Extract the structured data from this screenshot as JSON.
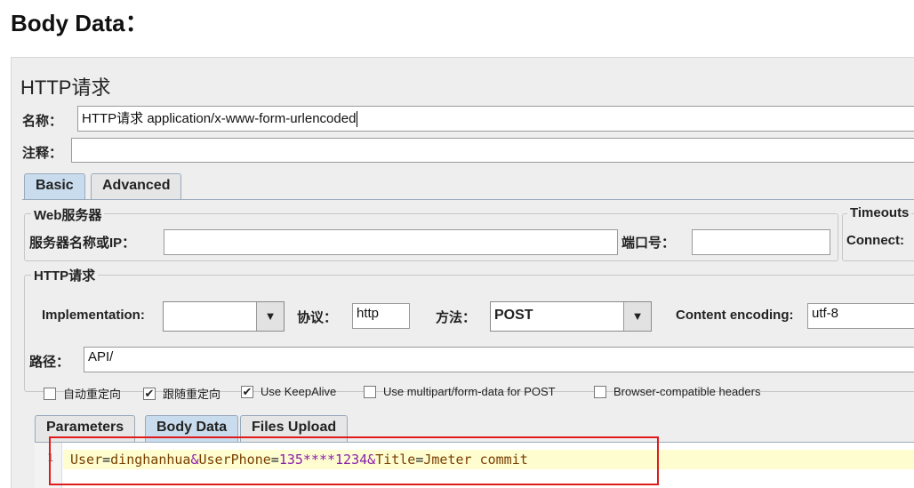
{
  "heading": "Body Data：",
  "panel_title": "HTTP请求",
  "name_label": "名称：",
  "name_value": "HTTP请求  application/x-www-form-urlencoded",
  "comment_label": "注释：",
  "tabs": [
    "Basic",
    "Advanced"
  ],
  "web_server": {
    "legend": "Web服务器",
    "server_label": "服务器名称或IP：",
    "server_value": "",
    "port_label": "端口号：",
    "port_value": ""
  },
  "timeouts": {
    "legend": "Timeouts",
    "connect_label": "Connect:"
  },
  "http_request": {
    "legend": "HTTP请求",
    "impl_label": "Implementation:",
    "impl_value": "",
    "protocol_label": "协议：",
    "protocol_value": "http",
    "method_label": "方法：",
    "method_value": "POST",
    "encoding_label": "Content encoding:",
    "encoding_value": "utf-8",
    "path_label": "路径：",
    "path_value": "API/"
  },
  "checkboxes": [
    {
      "label": "自动重定向",
      "checked": false
    },
    {
      "label": "跟随重定向",
      "checked": true
    },
    {
      "label": "Use KeepAlive",
      "checked": true
    },
    {
      "label": "Use multipart/form-data for POST",
      "checked": false
    },
    {
      "label": "Browser-compatible headers",
      "checked": false
    }
  ],
  "body_tabs": [
    "Parameters",
    "Body Data",
    "Files Upload"
  ],
  "body_data": {
    "line_number": "1",
    "segments": [
      "User",
      "=",
      "dinghanhua",
      "&",
      "UserPhone",
      "=",
      "135****1234",
      "&",
      "Title",
      "=",
      "Jmeter commit"
    ]
  },
  "icons": {
    "dropdown": "chevron-down-icon",
    "check": "check-icon"
  },
  "colors": {
    "highlight_box": "#e01b1b",
    "active_tab": "#c9dced",
    "line_highlight": "#fdfdd0"
  }
}
